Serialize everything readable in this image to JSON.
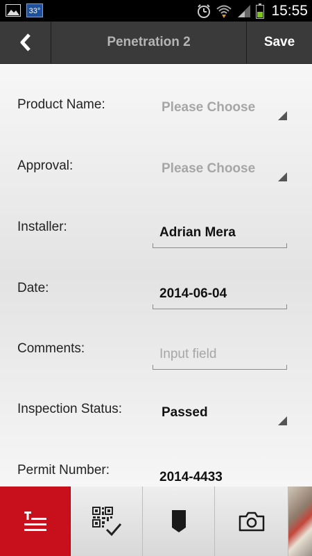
{
  "status_bar": {
    "temperature": "33°",
    "time": "15:55"
  },
  "app_bar": {
    "title": "Penetration 2",
    "save_label": "Save"
  },
  "form": {
    "product_name": {
      "label": "Product Name:",
      "value": "Please Choose"
    },
    "approval": {
      "label": "Approval:",
      "value": "Please Choose"
    },
    "installer": {
      "label": "Installer:",
      "value": "Adrian Mera"
    },
    "date": {
      "label": "Date:",
      "value": "2014-06-04"
    },
    "comments": {
      "label": "Comments:",
      "value": "",
      "placeholder": "Input field"
    },
    "inspection_status": {
      "label": "Inspection Status:",
      "value": "Passed"
    },
    "permit_number": {
      "label": "Permit Number:",
      "value": "2014-4433"
    }
  },
  "colors": {
    "accent": "#c8101d",
    "app_bar": "#3a3a3a",
    "status_bar": "#000000"
  },
  "bottom_tabs": [
    {
      "icon": "text-lines-icon",
      "active": true
    },
    {
      "icon": "qr-check-icon",
      "active": false
    },
    {
      "icon": "bookmark-icon",
      "active": false
    },
    {
      "icon": "camera-icon",
      "active": false
    }
  ]
}
